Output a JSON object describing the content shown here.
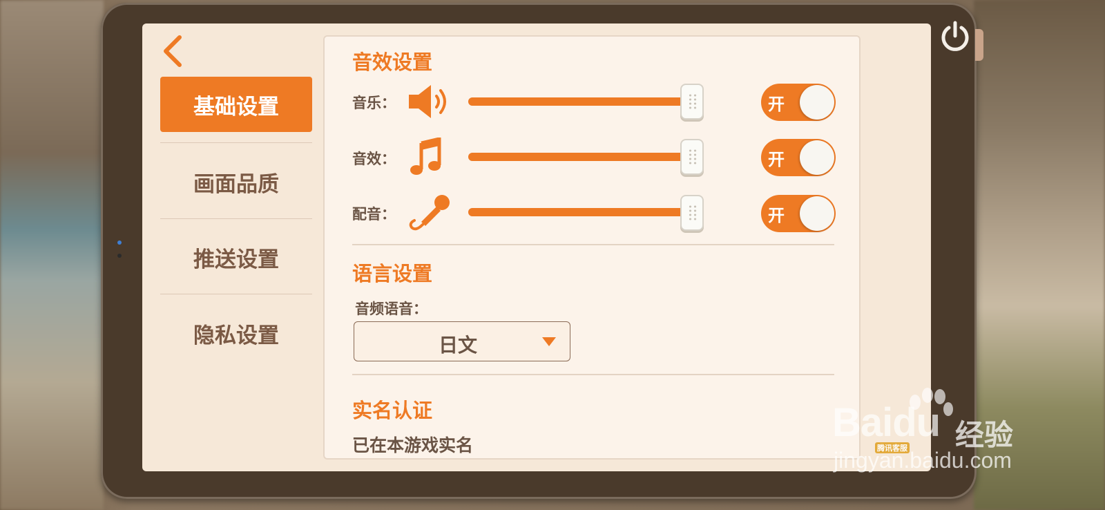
{
  "colors": {
    "accent": "#ee7a24",
    "panel_bg": "#fcf3ea",
    "screen_bg": "#f6e8d8",
    "text": "#6a5445"
  },
  "back_icon": "chevron-left-icon",
  "power_icon": "power-icon",
  "sidebar": {
    "items": [
      {
        "label": "基础设置",
        "active": true
      },
      {
        "label": "画面品质",
        "active": false
      },
      {
        "label": "推送设置",
        "active": false
      },
      {
        "label": "隐私设置",
        "active": false
      }
    ]
  },
  "sound": {
    "title": "音效设置",
    "rows": [
      {
        "label": "音乐：",
        "icon": "speaker-icon",
        "level": 1.0,
        "toggle": "开"
      },
      {
        "label": "音效：",
        "icon": "music-note-icon",
        "level": 1.0,
        "toggle": "开"
      },
      {
        "label": "配音：",
        "icon": "microphone-icon",
        "level": 1.0,
        "toggle": "开"
      }
    ]
  },
  "language": {
    "title": "语言设置",
    "label": "音频语音：",
    "selected": "日文"
  },
  "realname": {
    "title": "实名认证",
    "status": "已在本游戏实名"
  },
  "watermark": {
    "brand": "Baidu",
    "product": "经验",
    "badge": "腾讯客服",
    "url": "jingyan.baidu.com"
  }
}
